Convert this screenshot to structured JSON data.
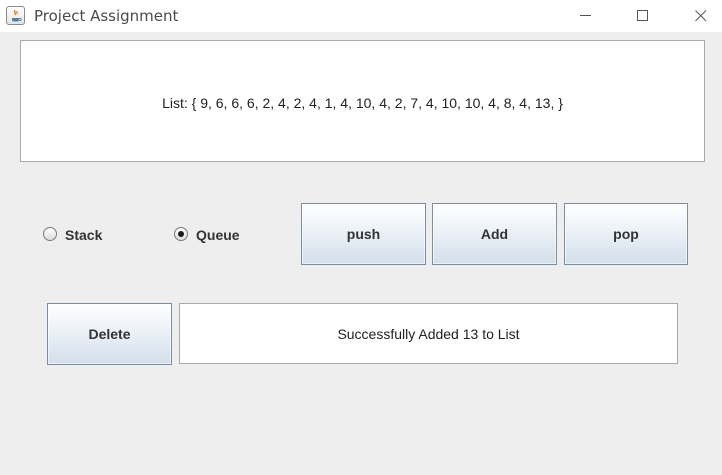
{
  "window": {
    "title": "Project Assignment"
  },
  "list_display": {
    "text": "List: { 9, 6, 6, 6, 2, 4, 2, 4, 1, 4, 10, 4, 2, 7, 4, 10, 10, 4, 8, 4, 13, }"
  },
  "mode": {
    "options": [
      {
        "label": "Stack",
        "selected": false
      },
      {
        "label": "Queue",
        "selected": true
      }
    ]
  },
  "buttons": {
    "push": "push",
    "add": "Add",
    "pop": "pop",
    "delete": "Delete"
  },
  "status": {
    "message": "Successfully Added 13 to List"
  },
  "icons": {
    "app": "java-icon",
    "minimize": "minimize-icon",
    "maximize": "maximize-icon",
    "close": "close-icon"
  }
}
